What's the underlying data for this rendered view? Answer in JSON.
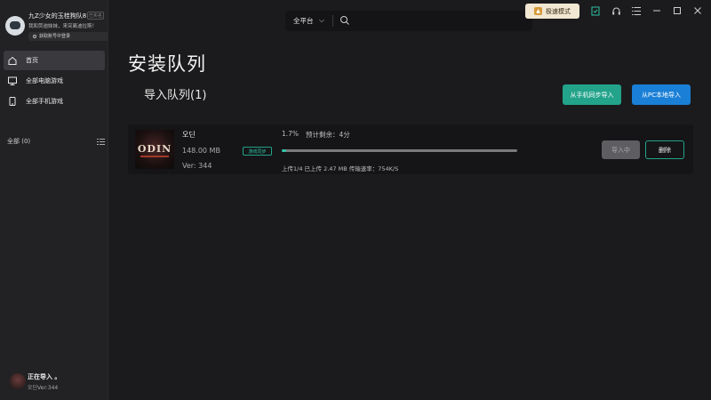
{
  "profile": {
    "username": "九Z少女的玉桂狗队8",
    "verified": "已实名",
    "subtitle": "我和荧迪妹妹，来突离迪拉斯！",
    "status": "获取账号中登录"
  },
  "sidebar": {
    "items": [
      {
        "label": "首页",
        "icon": "home-icon",
        "active": true
      },
      {
        "label": "全部电脑游戏",
        "icon": "monitor-icon",
        "active": false
      },
      {
        "label": "全部手机游戏",
        "icon": "phone-icon",
        "active": false
      }
    ],
    "filter_label": "全部 (0)"
  },
  "queue_status": {
    "title": "正在导入 。",
    "subtitle": "오딘Ver:344"
  },
  "topbar": {
    "platform": "全平台",
    "speed_mode": "极速模式",
    "icons": [
      "sync-check-icon",
      "headset-icon",
      "menu-icon",
      "minimize-icon",
      "maximize-icon",
      "close-icon"
    ]
  },
  "main": {
    "title": "安装队列",
    "section_title": "导入队列(1)",
    "btn_phone_sync": "从手机同步导入",
    "btn_pc_import": "从PC本地导入"
  },
  "task": {
    "thumb_logo": "ODIN",
    "name": "오딘",
    "size": "148.00 MB",
    "version": "Ver: 344",
    "tag": "游戏同步",
    "percent_text": "1.7%",
    "remaining": "预计剩余：4分",
    "progress": 0.017,
    "upload_info": "上传1/4 已上传 2.47 MB   传输速率：754K/S",
    "btn_importing": "导入中",
    "btn_delete": "删除"
  },
  "colors": {
    "accent_green": "#22a38a",
    "accent_blue": "#1a7fd6",
    "background": "#1b1b1d"
  }
}
